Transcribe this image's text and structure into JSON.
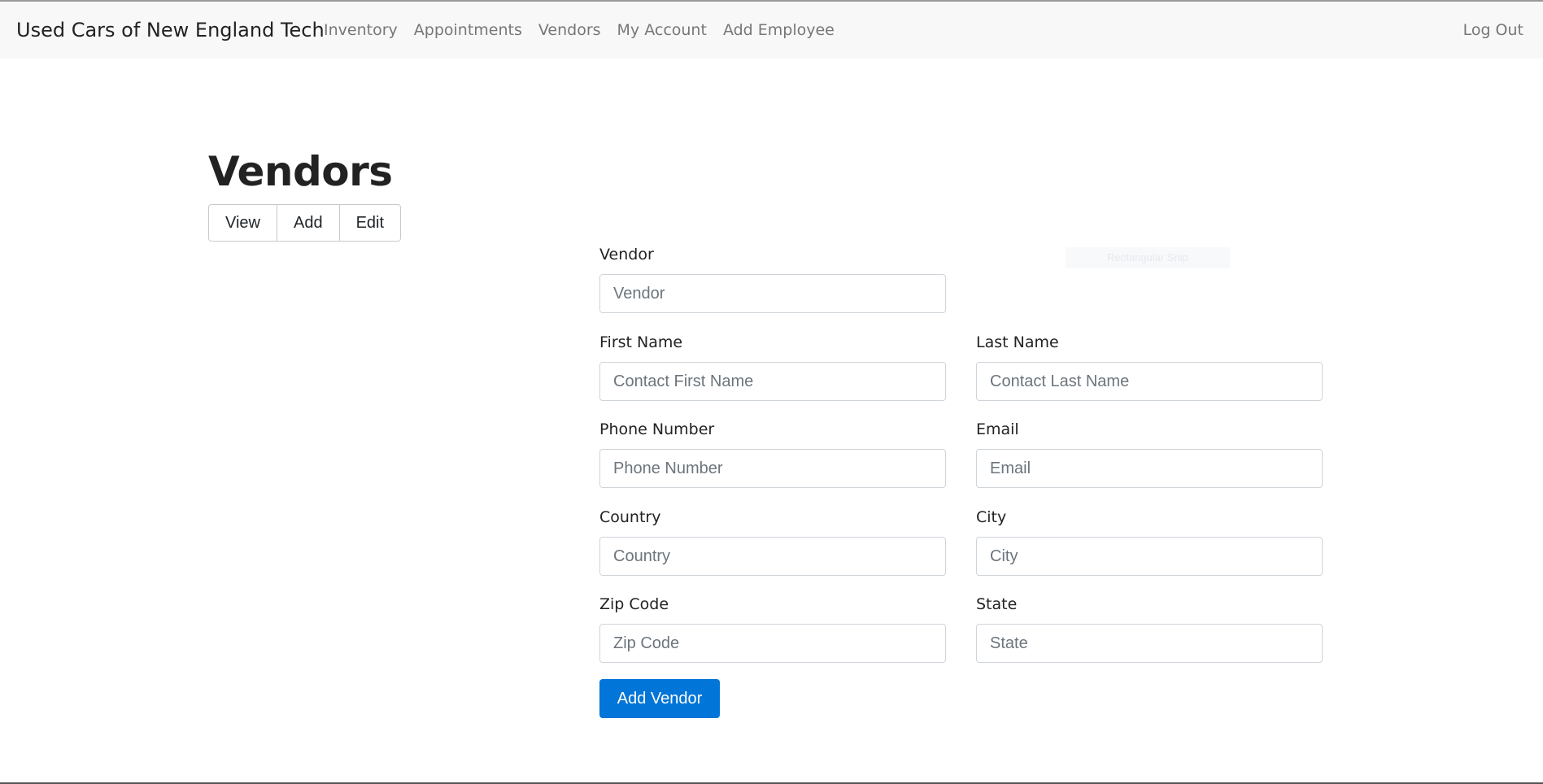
{
  "nav": {
    "brand": "Used Cars of New England Tech",
    "links": [
      "Inventory",
      "Appointments",
      "Vendors",
      "My Account",
      "Add Employee"
    ],
    "logout": "Log Out"
  },
  "page": {
    "title": "Vendors",
    "tabs": [
      "View",
      "Add",
      "Edit"
    ]
  },
  "overlay": {
    "faint_text": "Rectangular Snip"
  },
  "form": {
    "vendor": {
      "label": "Vendor",
      "placeholder": "Vendor"
    },
    "first_name": {
      "label": "First Name",
      "placeholder": "Contact First Name"
    },
    "last_name": {
      "label": "Last Name",
      "placeholder": "Contact Last Name"
    },
    "phone": {
      "label": "Phone Number",
      "placeholder": "Phone Number"
    },
    "email": {
      "label": "Email",
      "placeholder": "Email"
    },
    "country": {
      "label": "Country",
      "placeholder": "Country"
    },
    "city": {
      "label": "City",
      "placeholder": "City"
    },
    "zip": {
      "label": "Zip Code",
      "placeholder": "Zip Code"
    },
    "state": {
      "label": "State",
      "placeholder": "State"
    },
    "submit_label": "Add Vendor"
  }
}
